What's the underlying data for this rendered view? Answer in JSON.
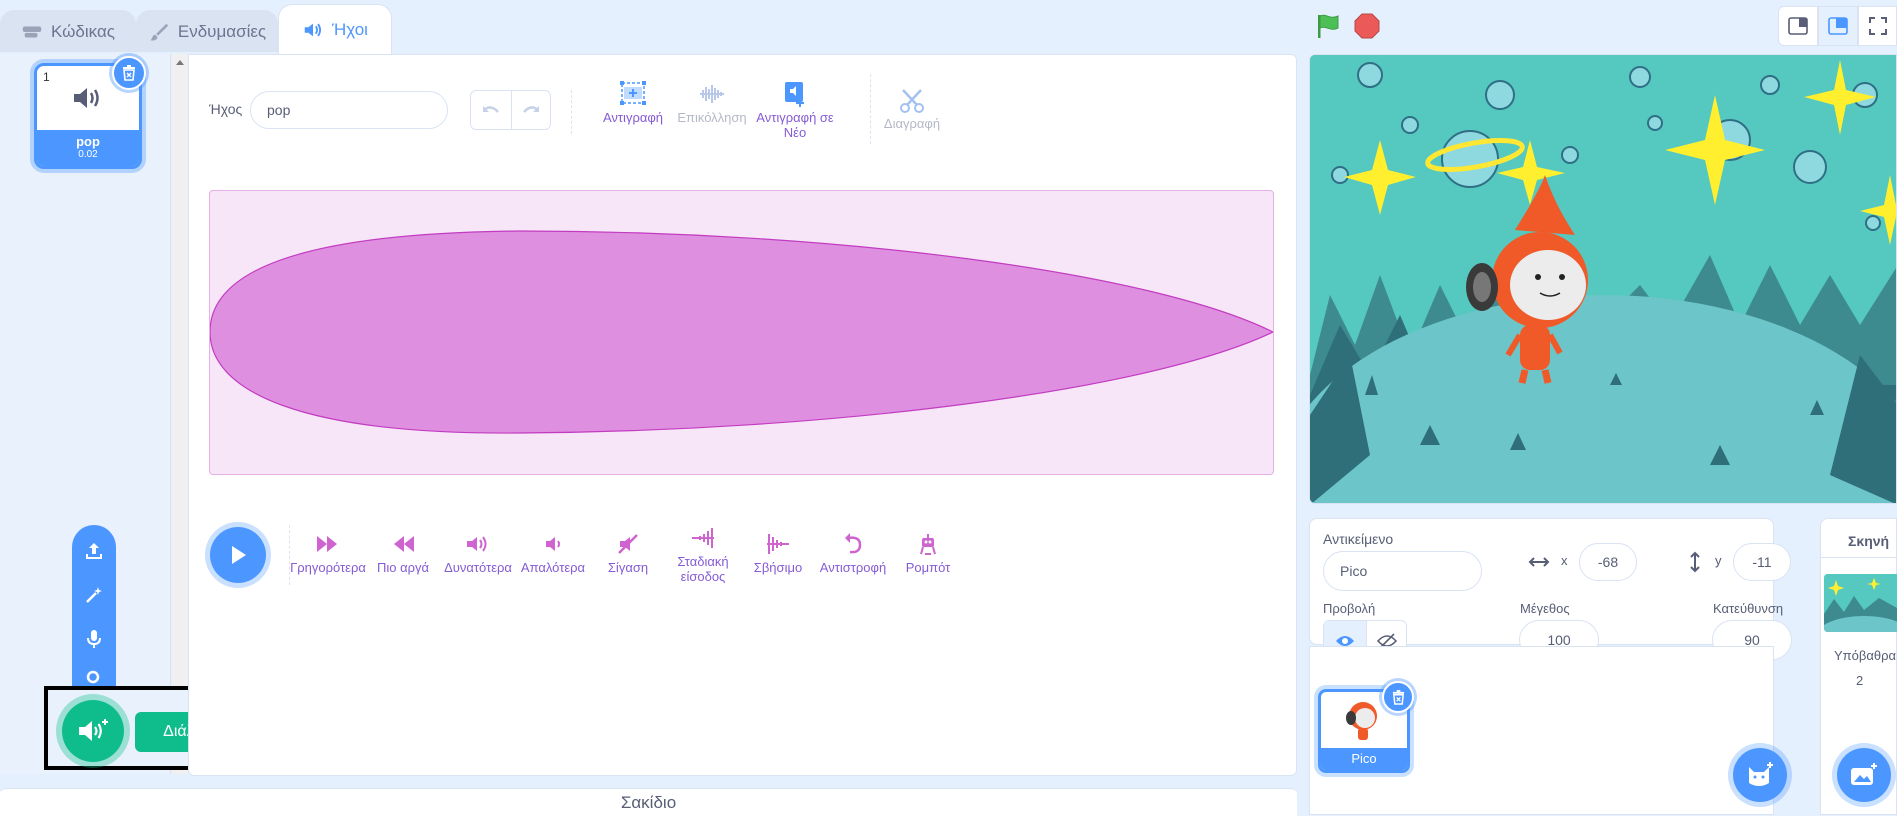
{
  "tabs": {
    "code": "Κώδικας",
    "costumes": "Ενδυμασίες",
    "sounds": "Ήχοι"
  },
  "sound_list": {
    "items": [
      {
        "number": "1",
        "name": "pop",
        "duration": "0.02"
      }
    ]
  },
  "editor": {
    "name_label": "Ήχος",
    "name_value": "pop",
    "tools": {
      "copy": "Αντιγραφή",
      "paste": "Επικόλληση",
      "copy_to_new": "Αντιγραφή σε Νέο",
      "delete": "Διαγραφή"
    },
    "effects": [
      {
        "label": "Γρηγορότερα",
        "icon": "faster-icon"
      },
      {
        "label": "Πιο αργά",
        "icon": "slower-icon"
      },
      {
        "label": "Δυνατότερα",
        "icon": "louder-icon"
      },
      {
        "label": "Απαλότερα",
        "icon": "softer-icon"
      },
      {
        "label": "Σίγαση",
        "icon": "mute-icon"
      },
      {
        "label": "Σταδιακή είσοδος",
        "icon": "fade-in-icon"
      },
      {
        "label": "Σβήσιμο",
        "icon": "fade-out-icon"
      },
      {
        "label": "Αντιστροφή",
        "icon": "reverse-icon"
      },
      {
        "label": "Ρομπότ",
        "icon": "robot-icon"
      }
    ]
  },
  "sound_menu": {
    "tooltip": "Διάλεξε Ήχο"
  },
  "backpack": {
    "label": "Σακίδιο"
  },
  "sprite_info": {
    "sprite_label": "Αντικείμενο",
    "sprite_name": "Pico",
    "x_label": "x",
    "x_value": "-68",
    "y_label": "y",
    "y_value": "-11",
    "show_label": "Προβολή",
    "size_label": "Μέγεθος",
    "size_value": "100",
    "direction_label": "Κατεύθυνση",
    "direction_value": "90"
  },
  "sprites": [
    {
      "name": "Pico"
    }
  ],
  "stage_panel": {
    "title": "Σκηνή",
    "backdrops_label": "Υπόβαθρα",
    "backdrops_count": "2"
  },
  "colors": {
    "accent": "#4c97ff",
    "sound_purple": "#855cd6",
    "wave_fill": "#df8fdf",
    "green": "#0fbd8c"
  }
}
